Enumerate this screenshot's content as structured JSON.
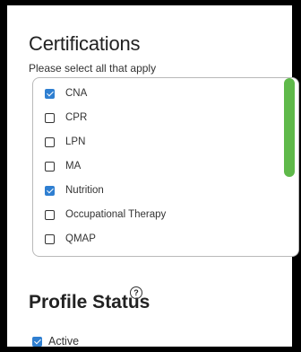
{
  "certifications": {
    "title": "Certifications",
    "instruction": "Please select all that apply",
    "options": [
      {
        "label": "CNA",
        "checked": true
      },
      {
        "label": "CPR",
        "checked": false
      },
      {
        "label": "LPN",
        "checked": false
      },
      {
        "label": "MA",
        "checked": false
      },
      {
        "label": "Nutrition",
        "checked": true
      },
      {
        "label": "Occupational Therapy",
        "checked": false
      },
      {
        "label": "QMAP",
        "checked": false
      }
    ],
    "scroll_position": 0.0
  },
  "profile_status": {
    "title": "Profile Status",
    "help_icon": "question-circle",
    "help_symbol": "?",
    "active_label": "Active",
    "active_checked": true
  },
  "colors": {
    "checkbox_checked": "#2f7fd1",
    "scrollbar_thumb": "#5fb94a",
    "frame": "#000000"
  }
}
